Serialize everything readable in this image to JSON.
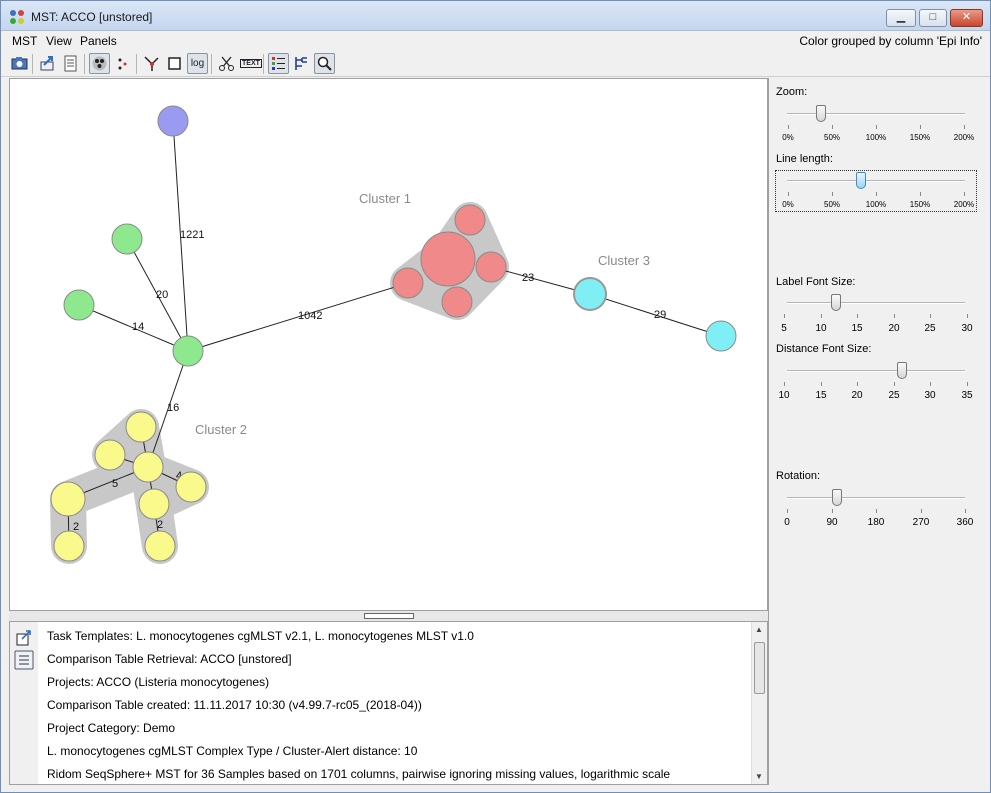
{
  "window": {
    "title": "MST: ACCO [unstored]",
    "minimize": "▁",
    "maximize": "□",
    "close": "✕"
  },
  "menu": {
    "items": [
      "MST",
      "View",
      "Panels"
    ],
    "status": "Color grouped by column 'Epi Info'"
  },
  "toolbar": {
    "buttons": [
      {
        "icon": "camera-icon"
      },
      {
        "icon": "export-icon"
      },
      {
        "icon": "document-icon"
      },
      {
        "icon": "group-nodes-icon",
        "pressed": true
      },
      {
        "icon": "dots-icon"
      },
      {
        "icon": "branch-icon"
      },
      {
        "icon": "square-icon"
      },
      {
        "icon": "log-icon",
        "label": "log",
        "pressed": true
      },
      {
        "icon": "scissors-icon"
      },
      {
        "icon": "text-icon",
        "label": "TEXT"
      },
      {
        "icon": "list-icon",
        "pressed": true
      },
      {
        "icon": "tree-icon"
      },
      {
        "icon": "magnifier-icon",
        "pressed": true
      }
    ]
  },
  "mst": {
    "cluster_labels": [
      "Cluster 1",
      "Cluster 2",
      "Cluster 3"
    ],
    "edge_labels": [
      "1221",
      "20",
      "14",
      "1042",
      "23",
      "29",
      "16",
      "5",
      "4",
      "2",
      "2"
    ],
    "colors": {
      "cluster1": "#f08a8a",
      "cluster2": "#fafa8c",
      "cluster3": "#80eef5",
      "green": "#8ee88e",
      "blue": "#9a9af0",
      "halo": "#c8c8c8"
    }
  },
  "info": {
    "lines": [
      "Task Templates: L. monocytogenes cgMLST v2.1, L. monocytogenes MLST v1.0",
      "Comparison Table Retrieval: ACCO [unstored]",
      "Projects: ACCO (Listeria monocytogenes)",
      "Comparison Table created: 11.11.2017 10:30 (v4.99.7-rc05_(2018-04))",
      "Project Category: Demo",
      "L. monocytogenes cgMLST Complex Type / Cluster-Alert distance: 10",
      "Ridom SeqSphere+ MST for 36 Samples based on 1701 columns, pairwise ignoring missing values, logarithmic scale"
    ]
  },
  "controls": {
    "zoom": {
      "label": "Zoom:",
      "ticks": [
        "0%",
        "50%",
        "100%",
        "150%",
        "200%"
      ],
      "value_percent": 40
    },
    "line_length": {
      "label": "Line length:",
      "ticks": [
        "0%",
        "50%",
        "100%",
        "150%",
        "200%"
      ],
      "value_percent": 83
    },
    "label_font": {
      "label": "Label Font Size:",
      "ticks": [
        "5",
        "10",
        "15",
        "20",
        "25",
        "30"
      ],
      "value": 12
    },
    "distance_font": {
      "label": "Distance Font Size:",
      "ticks": [
        "10",
        "15",
        "20",
        "25",
        "30",
        "35"
      ],
      "value": 27
    },
    "rotation": {
      "label": "Rotation:",
      "ticks": [
        "0",
        "90",
        "180",
        "270",
        "360"
      ],
      "value": 90
    }
  }
}
